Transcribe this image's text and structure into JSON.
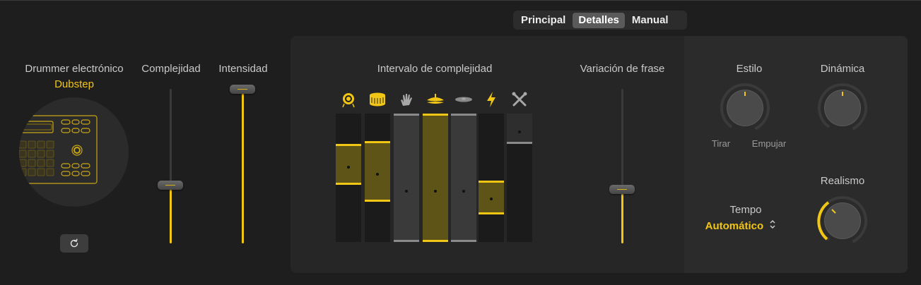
{
  "tabs": [
    {
      "label": "Principal",
      "active": false
    },
    {
      "label": "Detalles",
      "active": true
    },
    {
      "label": "Manual",
      "active": false
    }
  ],
  "drummer": {
    "title": "Drummer electrónico",
    "style": "Dubstep",
    "refresh_icon": "refresh-icon"
  },
  "sliders": {
    "complexity": {
      "label": "Complejidad",
      "value": 0.38
    },
    "intensity": {
      "label": "Intensidad",
      "value": 1.0
    },
    "phrase_variation": {
      "label": "Variación de frase",
      "value": 0.35
    }
  },
  "complexity_range": {
    "title": "Intervalo de complejidad",
    "columns": [
      {
        "icon": "kick-drum-icon",
        "enabled": true
      },
      {
        "icon": "snare-drum-icon",
        "enabled": true
      },
      {
        "icon": "clap-hand-icon",
        "enabled": false
      },
      {
        "icon": "hi-hat-icon",
        "enabled": true
      },
      {
        "icon": "cymbal-icon",
        "enabled": false
      },
      {
        "icon": "lightning-icon",
        "enabled": true
      },
      {
        "icon": "crossed-sticks-icon",
        "enabled": false
      }
    ]
  },
  "knobs": {
    "style": {
      "label": "Estilo",
      "left_label": "Tirar",
      "right_label": "Empujar"
    },
    "dynamics": {
      "label": "Dinámica"
    },
    "realism": {
      "label": "Realismo"
    }
  },
  "tempo": {
    "label": "Tempo",
    "value": "Automático"
  },
  "colors": {
    "accent": "#f2c615",
    "panel": "#262626",
    "background": "#1e1e1e"
  }
}
